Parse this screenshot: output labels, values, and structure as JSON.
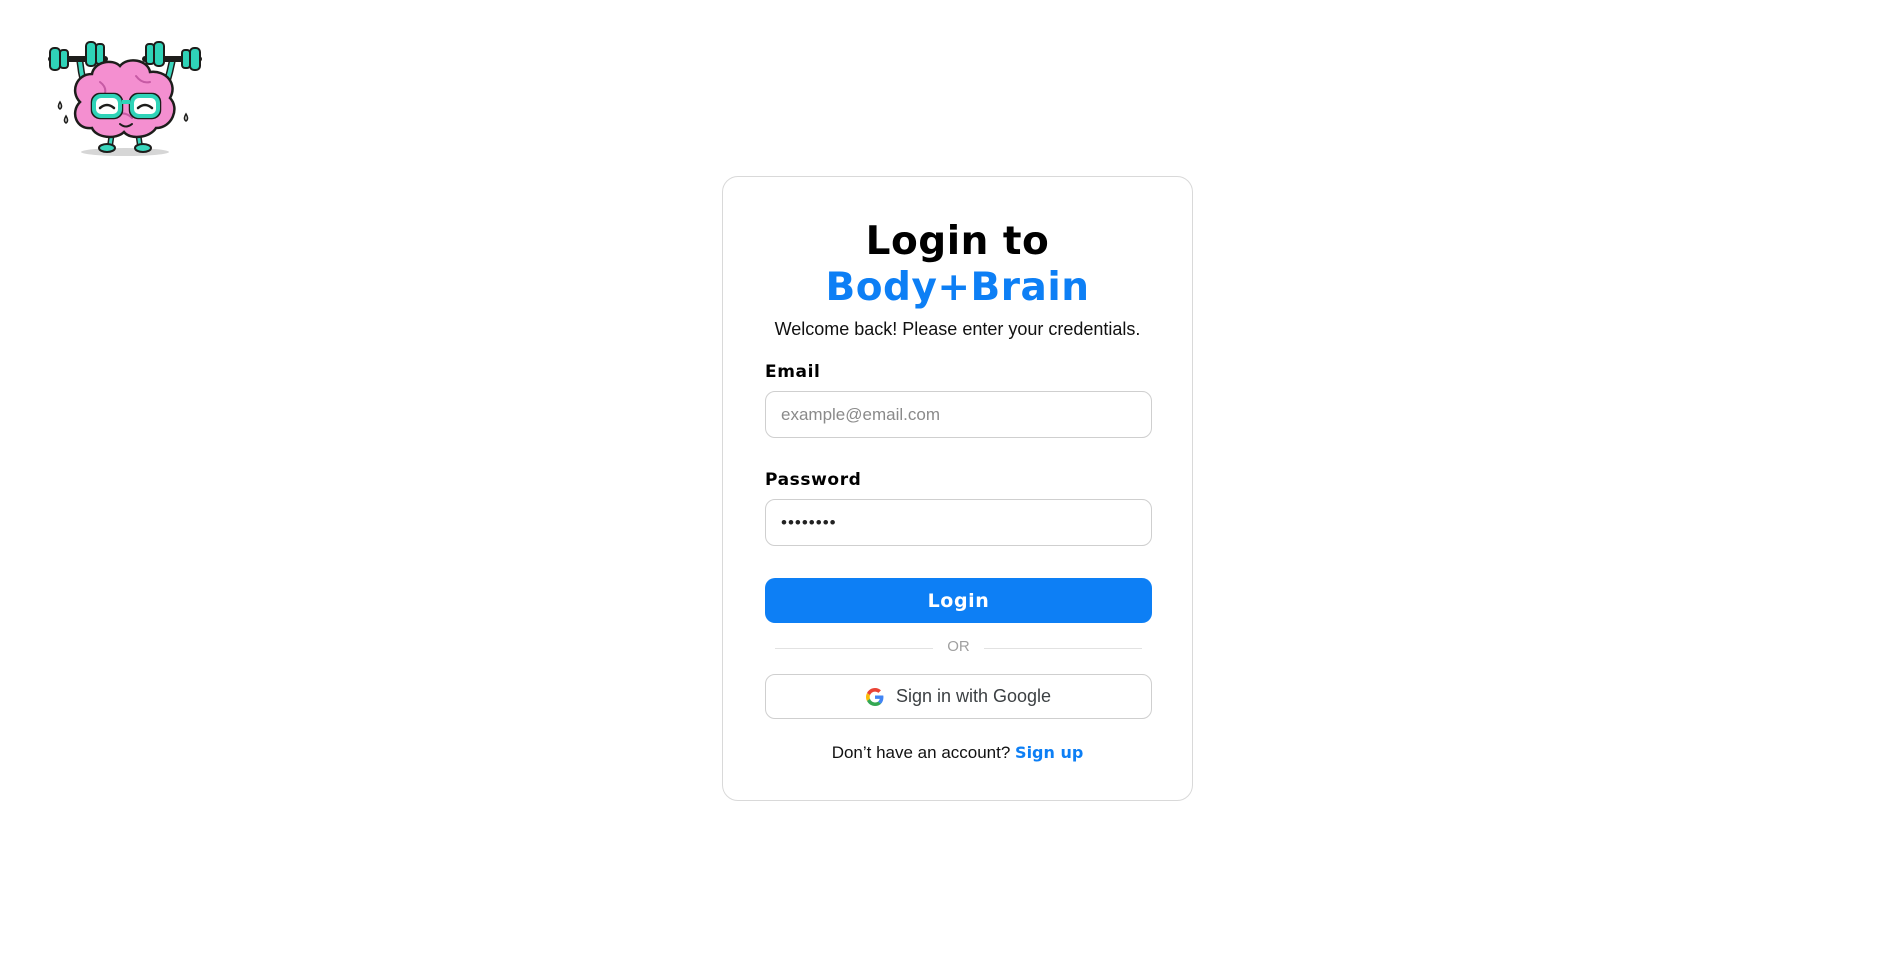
{
  "brand": {
    "logo_icon": "brain-lifting-dumbbells-mascot",
    "accent_color": "#0d7ff5"
  },
  "login_card": {
    "title_line1": "Login to",
    "title_line2": "Body+Brain",
    "subtitle": "Welcome back! Please enter your credentials.",
    "email": {
      "label": "Email",
      "placeholder": "example@email.com",
      "value": ""
    },
    "password": {
      "label": "Password",
      "value": "••••••••"
    },
    "login_button": "Login",
    "divider_text": "OR",
    "google_button": "Sign in with Google",
    "google_icon": "google-g-icon",
    "signup_prompt": "Don’t have an account? ",
    "signup_link": "Sign up"
  }
}
